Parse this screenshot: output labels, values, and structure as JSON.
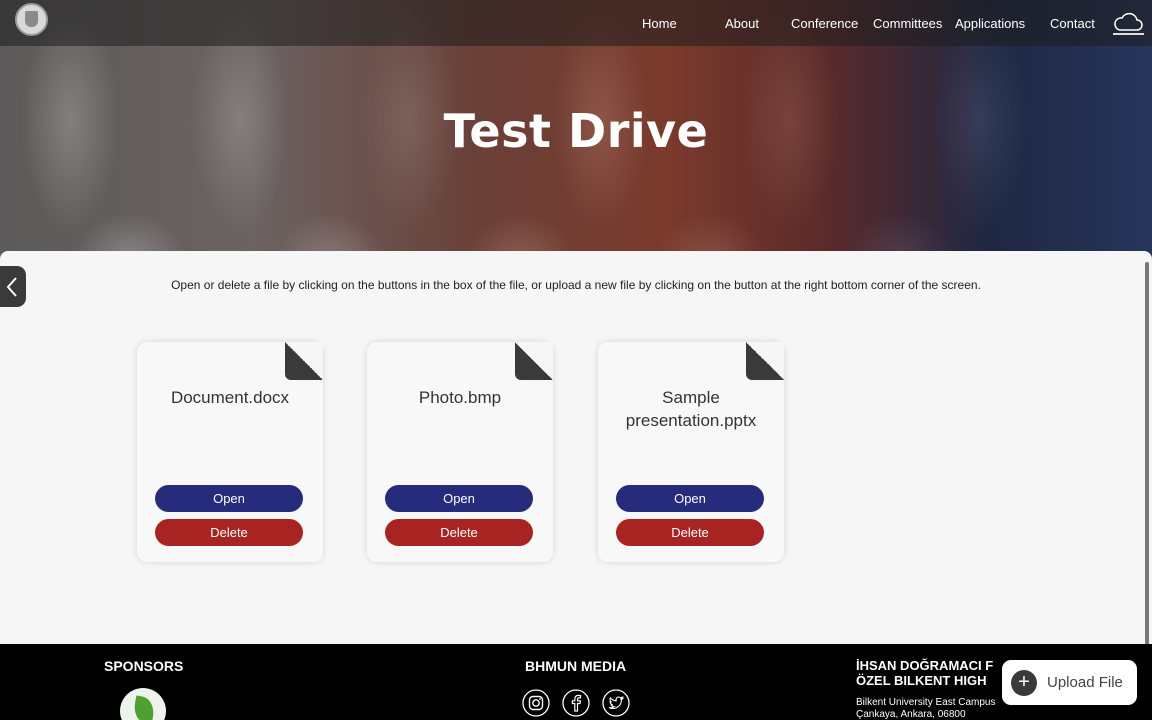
{
  "nav": {
    "items": [
      {
        "label": "Home"
      },
      {
        "label": "About"
      },
      {
        "label": "Conference"
      },
      {
        "label": "Committees"
      },
      {
        "label": "Applications"
      },
      {
        "label": "Contact"
      }
    ],
    "cloud_icon": "cloud-icon",
    "logo_icon": "school-crest-icon"
  },
  "hero": {
    "title": "Test Drive"
  },
  "main": {
    "instructions": "Open or delete a file by clicking on the buttons in the box of the file, or upload a new file by clicking on the button at the right bottom corner of the screen.",
    "files": [
      {
        "name": "Document.docx",
        "open_label": "Open",
        "delete_label": "Delete"
      },
      {
        "name": "Photo.bmp",
        "open_label": "Open",
        "delete_label": "Delete"
      },
      {
        "name": "Sample presentation.pptx",
        "open_label": "Open",
        "delete_label": "Delete"
      }
    ],
    "side_toggle_icon": "chevron-left-icon"
  },
  "footer": {
    "sponsors_heading": "SPONSORS",
    "media_heading": "BHMUN MEDIA",
    "media_icons": [
      "instagram-icon",
      "facebook-icon",
      "twitter-icon"
    ],
    "school_line1": "İHSAN DOĞRAMACI F",
    "school_line2": "ÖZEL BILKENT HIGH",
    "address_line1": "Bilkent University East Campus",
    "address_line2": "Çankaya, Ankara, 06800"
  },
  "upload": {
    "label": "Upload File",
    "icon": "+"
  },
  "colors": {
    "open_button": "#262b7b",
    "delete_button": "#a82422",
    "content_bg": "#f7f6f6",
    "footer_bg": "#000000"
  }
}
